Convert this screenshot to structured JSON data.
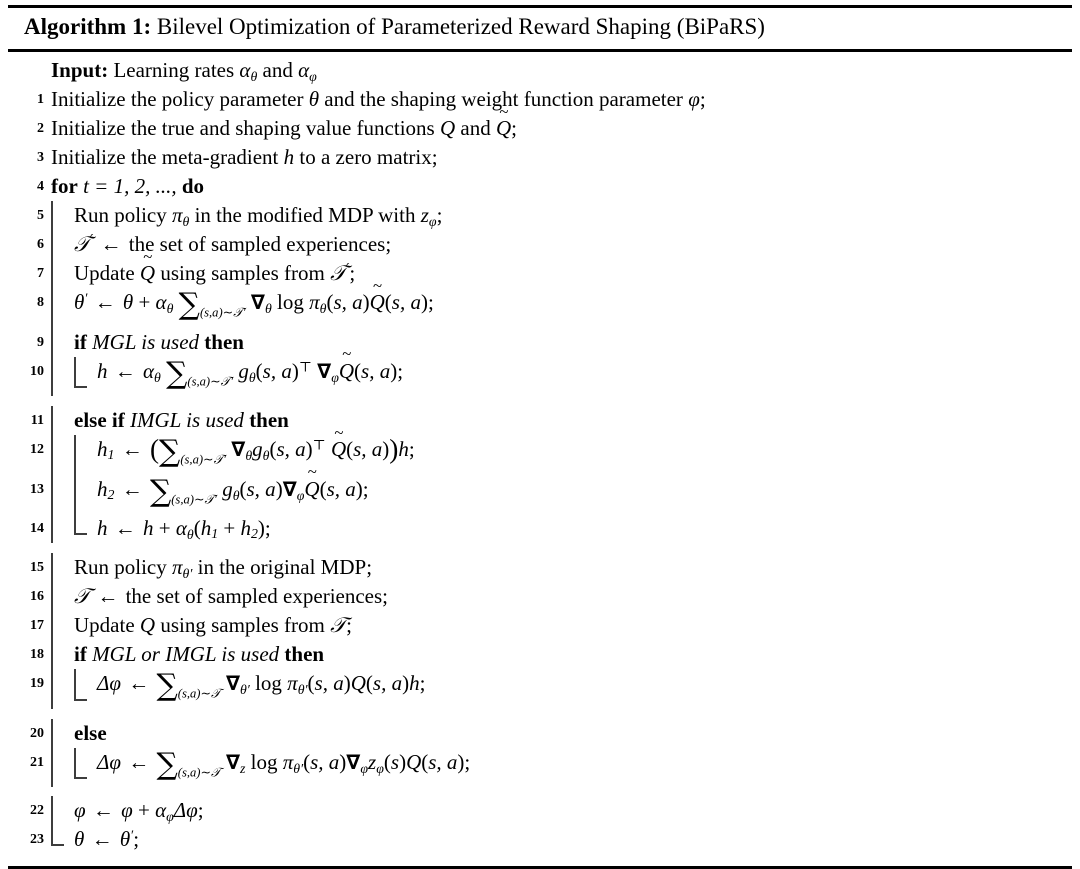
{
  "figure": {
    "caption_label": "Algorithm 1:",
    "caption_title": "Bilevel Optimization of Parameterized Reward Shaping (BiPaRS)",
    "input_label": "Input:",
    "input_text": "Learning rates",
    "input_sym_1": "α",
    "input_sym_1_sub": "θ",
    "input_conj": "and",
    "input_sym_2": "α",
    "input_sym_2_sub": "φ",
    "rule_color": "#000000",
    "guide_color": "#3d3d3d"
  },
  "lines": {
    "n1": "1",
    "n2": "2",
    "n3": "3",
    "n4": "4",
    "n5": "5",
    "n6": "6",
    "n7": "7",
    "n8": "8",
    "n9": "9",
    "n10": "10",
    "n11": "11",
    "n12": "12",
    "n13": "13",
    "n14": "14",
    "n15": "15",
    "n16": "16",
    "n17": "17",
    "n18": "18",
    "n19": "19",
    "n20": "20",
    "n21": "21",
    "n22": "22",
    "n23": "23"
  },
  "text": {
    "l1_a": "Initialize the policy parameter",
    "l1_b": "and the shaping weight function parameter",
    "l2_a": "Initialize the true and shaping value functions",
    "l2_b": "and",
    "l3_a": "Initialize the meta-gradient",
    "l3_b": "to a zero matrix;",
    "l4_kw_for": "for",
    "l4_expr": "t = 1, 2, ...,",
    "l4_kw_do": "do",
    "l5_a": "Run policy",
    "l5_b": "in the modified MDP with",
    "l6_b": "the set of sampled experiences;",
    "l7_a": "Update",
    "l7_b": "using samples from",
    "l9_kw_if": "if",
    "l9_it": "MGL is used",
    "l9_kw_then": "then",
    "l11_kw_elseif": "else if",
    "l11_it": "IMGL is used",
    "l11_kw_then": "then",
    "l15_a": "Run policy",
    "l15_b": "in the original MDP;",
    "l16_b": "the set of sampled experiences;",
    "l17_a": "Update",
    "l17_b": "using samples from",
    "l18_kw_if": "if",
    "l18_it": "MGL or IMGL is used",
    "l18_kw_then": "then",
    "l20_kw_else": "else"
  },
  "algorithm_steps": [
    {
      "no": "",
      "text": "Input: Learning rates α_θ and α_φ"
    },
    {
      "no": "1",
      "text": "Initialize the policy parameter θ and the shaping weight function parameter φ;"
    },
    {
      "no": "2",
      "text": "Initialize the true and shaping value functions Q and Q̃;"
    },
    {
      "no": "3",
      "text": "Initialize the meta-gradient h to a zero matrix;"
    },
    {
      "no": "4",
      "text": "for t = 1, 2, ..., do"
    },
    {
      "no": "5",
      "text": "Run policy π_θ in the modified MDP with z_φ;"
    },
    {
      "no": "6",
      "text": "T' ← the set of sampled experiences;"
    },
    {
      "no": "7",
      "text": "Update Q̃ using samples from T';"
    },
    {
      "no": "8",
      "text": "θ' ← θ + α_θ Σ_{(s,a)~T'} ∇_θ log π_θ(s,a)Q̃(s,a);"
    },
    {
      "no": "9",
      "text": "if MGL is used then"
    },
    {
      "no": "10",
      "text": "h ← α_θ Σ_{(s,a)~T'} g_θ(s,a)^⊤ ∇_φ Q̃(s,a);"
    },
    {
      "no": "11",
      "text": "else if IMGL is used then"
    },
    {
      "no": "12",
      "text": "h₁ ← ( Σ_{(s,a)~T'} ∇_θ g_θ(s,a)^⊤ Q̃(s,a) )h;"
    },
    {
      "no": "13",
      "text": "h₂ ← Σ_{(s,a)~T'} g_θ(s,a)∇_φ Q̃(s,a);"
    },
    {
      "no": "14",
      "text": "h ← h + α_θ(h₁ + h₂);"
    },
    {
      "no": "15",
      "text": "Run policy π_θ' in the original MDP;"
    },
    {
      "no": "16",
      "text": "T ← the set of sampled experiences;"
    },
    {
      "no": "17",
      "text": "Update Q using samples from T;"
    },
    {
      "no": "18",
      "text": "if MGL or IMGL is used then"
    },
    {
      "no": "19",
      "text": "Δφ ← Σ_{(s,a)~T} ∇_θ' log π_θ'(s,a)Q(s,a)h;"
    },
    {
      "no": "20",
      "text": "else"
    },
    {
      "no": "21",
      "text": "Δφ ← Σ_{(s,a)~T} ∇_z log π_θ'(s,a)∇_φ z_φ(s)Q(s,a);"
    },
    {
      "no": "22",
      "text": "φ ← φ + α_φ Δφ;"
    },
    {
      "no": "23",
      "text": "θ ← θ';"
    }
  ]
}
